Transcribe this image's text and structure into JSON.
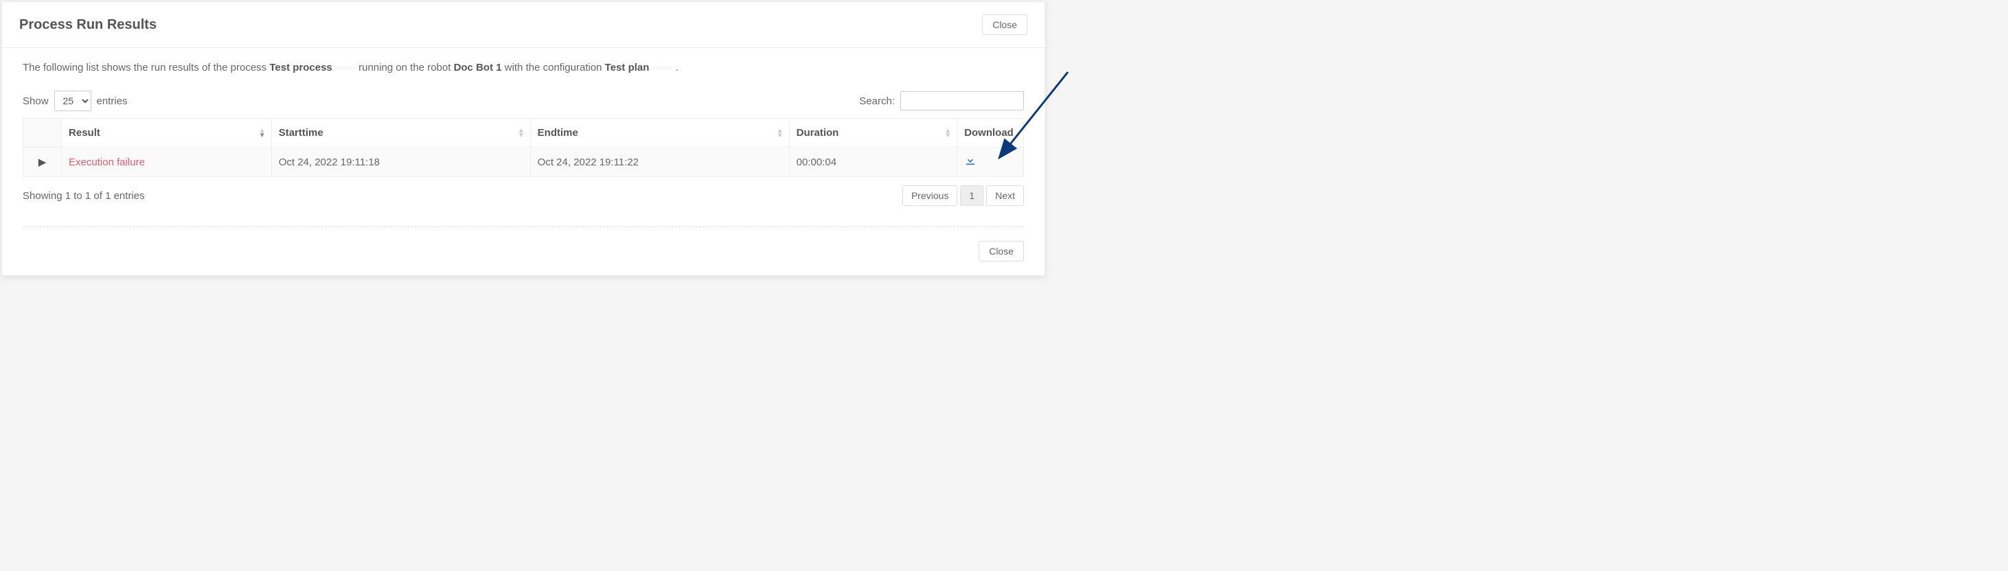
{
  "header": {
    "title": "Process Run Results",
    "close_label": "Close"
  },
  "intro": {
    "pre": "The following list shows the run results of the process ",
    "process_name": "Test process",
    "process_suffix_blur": "——",
    "mid": " running on the robot ",
    "robot_name": "Doc Bot 1",
    "with_conf": " with the configuration ",
    "plan_name": "Test plan",
    "plan_suffix_blur": "——",
    "after": "."
  },
  "controls": {
    "show_label": "Show",
    "entries_label": "entries",
    "page_size": "25",
    "search_label": "Search:",
    "search_value": ""
  },
  "columns": {
    "result": "Result",
    "starttime": "Starttime",
    "endtime": "Endtime",
    "duration": "Duration",
    "download": "Download"
  },
  "rows": [
    {
      "result": "Execution failure",
      "starttime": "Oct 24, 2022 19:11:18",
      "endtime": "Oct 24, 2022 19:11:22",
      "duration": "00:00:04"
    }
  ],
  "footer": {
    "info": "Showing 1 to 1 of 1 entries",
    "prev": "Previous",
    "page": "1",
    "next": "Next",
    "close": "Close"
  }
}
